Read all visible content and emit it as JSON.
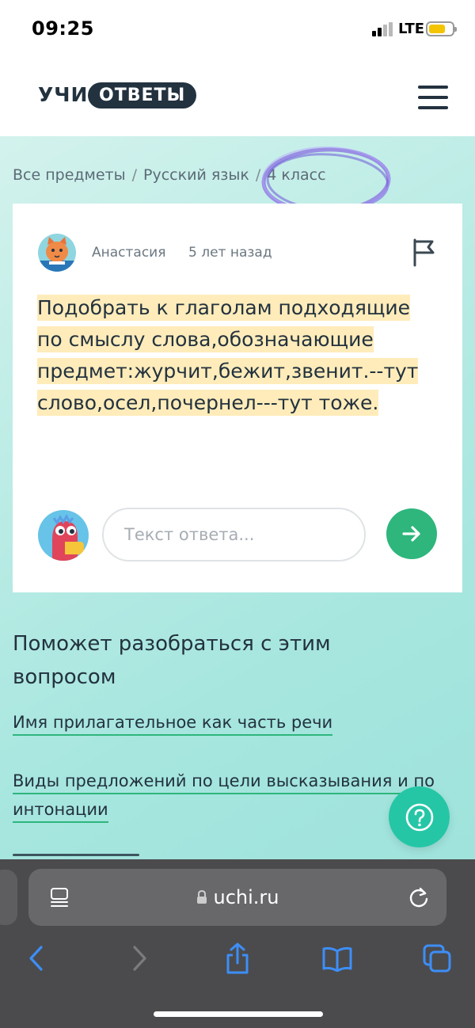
{
  "status_bar": {
    "time": "09:25",
    "network": "LTE",
    "battery_color": "#f5c400"
  },
  "header": {
    "logo_part1": "УЧИ",
    "logo_part2": "ОТВЕТЫ",
    "menu_icon": "hamburger-menu-icon"
  },
  "breadcrumbs": [
    {
      "label": "Все предметы"
    },
    {
      "label": "Русский язык"
    },
    {
      "label": "4 класс"
    }
  ],
  "breadcrumb_separator": "/",
  "question": {
    "author": "Анастасия",
    "time_ago": "5 лет назад",
    "text": "Подобрать к глаголам подходящие по смыслу слова,обозначающие предмет:журчит,бежит,звенит.--тут слово,осел,почернел---тут тоже.",
    "report_icon": "flag-icon"
  },
  "answer": {
    "placeholder": "Текст ответа...",
    "send_icon": "arrow-right-icon"
  },
  "help": {
    "title": "Поможет разобраться с этим вопросом",
    "topics": [
      {
        "label": "Имя прилагательное как часть речи"
      },
      {
        "label": "Виды предложений по цели высказывания и по интонации"
      }
    ],
    "fab_icon": "question-circle-icon"
  },
  "browser": {
    "url": "uchi.ru"
  },
  "colors": {
    "brand_dark": "#23323f",
    "accent_green": "#2eb67d",
    "highlight": "#ffecba",
    "help_fab": "#25c6a6",
    "safari_bar": "#4b4b4d"
  }
}
